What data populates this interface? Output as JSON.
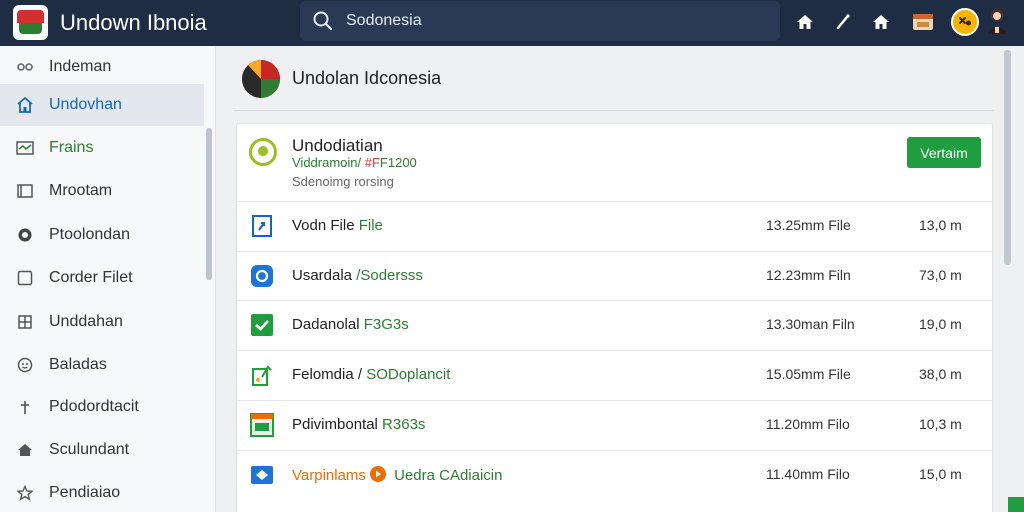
{
  "app": {
    "title": "Undown Ibnoia"
  },
  "search": {
    "value": "Sodonesia"
  },
  "toolbar_icons": [
    "home-icon",
    "pen-icon",
    "home-icon",
    "folder-icon",
    "badge-icon",
    "user-avatar"
  ],
  "sidebar": {
    "items": [
      {
        "label": "Indeman",
        "icon": "link-icon"
      },
      {
        "label": "Undovhan",
        "icon": "house-icon",
        "active": true
      },
      {
        "label": "Frains",
        "icon": "mail-icon"
      },
      {
        "label": "Mrootam",
        "icon": "image-icon"
      },
      {
        "label": "Ptoolondan",
        "icon": "circle-icon"
      },
      {
        "label": "Corder Filet",
        "icon": "square-icon"
      },
      {
        "label": "Unddahan",
        "icon": "building-icon"
      },
      {
        "label": "Baladas",
        "icon": "gear-icon"
      },
      {
        "label": "Pdodordtacit",
        "icon": "pin-icon"
      },
      {
        "label": "Sculundant",
        "icon": "home-icon"
      },
      {
        "label": "Pendiaiao",
        "icon": "star-icon"
      }
    ]
  },
  "main": {
    "title": "Undolan Idconesia",
    "card": {
      "title": "Undodiatian",
      "sub1_a": "Viddramoin/ ",
      "sub1_b": "#F",
      "sub1_c": "F1200",
      "sub2": "Sdenoimg rorsing",
      "button": "Vertaim"
    },
    "files": [
      {
        "icon": "file-icon",
        "name": "Vodn File ",
        "name_extra": "File",
        "info": "13.25mm File",
        "size": "13,0 m"
      },
      {
        "icon": "sync-icon",
        "name": "Usardala ",
        "name_extra": "/Sodersss",
        "info": "12.23mm Filn",
        "size": "73,0 m"
      },
      {
        "icon": "check-icon",
        "name": "Dadanolal ",
        "name_extra": "F3G3s",
        "info": "13.30man Filn",
        "size": "19,0 m"
      },
      {
        "icon": "upload-icon",
        "name": "Felomdia / ",
        "name_extra": "SODoplancit",
        "info": "15.05mm File",
        "size": "38,0 m"
      },
      {
        "icon": "archive-icon",
        "name": "Pdivimbontal ",
        "name_extra": "R363s",
        "info": "11.20mm Filo",
        "size": "10,3 m"
      },
      {
        "icon": "forward-icon",
        "name": "Varpinlams ",
        "name_extra": "Uedra CAdiaicin",
        "info": "11.40mm Filo",
        "size": "15,0 m"
      }
    ]
  },
  "colors": {
    "topbar": "#1f2d44",
    "accent": "#1565c0",
    "green": "#1e9e3e",
    "orange": "#ef6c00"
  }
}
